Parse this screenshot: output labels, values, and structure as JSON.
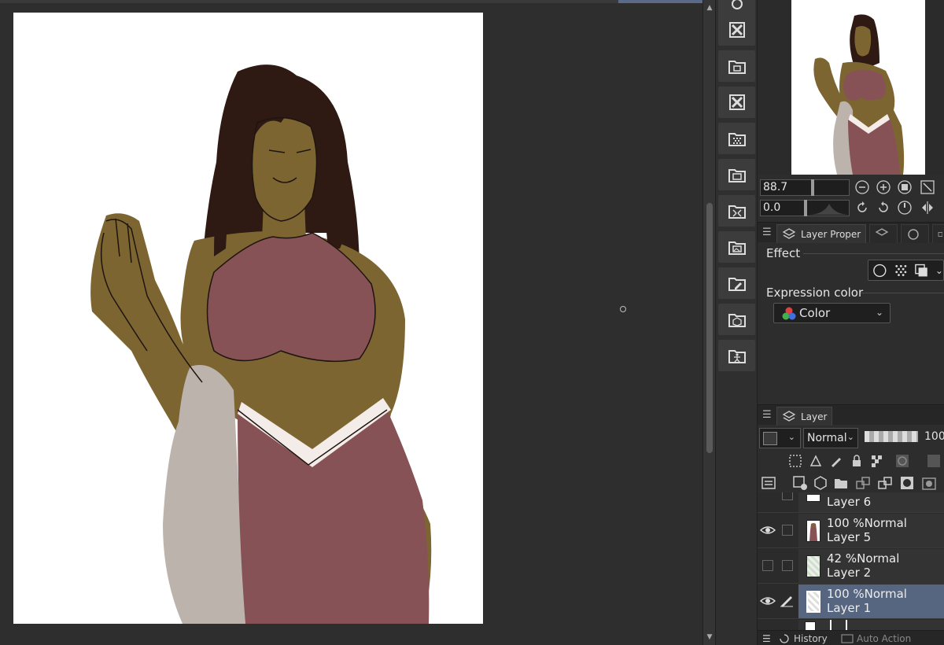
{
  "navigator": {
    "zoom_value": "88.7",
    "rotation_value": "0.0"
  },
  "property_panel": {
    "tab_label": "Layer Proper",
    "effect_label": "Effect",
    "expression_color_label": "Expression color",
    "expression_color_value": "Color"
  },
  "layer_panel": {
    "tab_label": "Layer",
    "blend_mode": "Normal",
    "opacity": "100",
    "layers": [
      {
        "opacity": "",
        "mode": "",
        "name": "Layer 6",
        "visible": false,
        "selected": false
      },
      {
        "opacity": "100 %",
        "mode": "Normal",
        "name": "Layer 5",
        "visible": true,
        "selected": false
      },
      {
        "opacity": "42 %",
        "mode": "Normal",
        "name": "Layer 2",
        "visible": false,
        "selected": false
      },
      {
        "opacity": "100 %",
        "mode": "Normal",
        "name": "Layer 1",
        "visible": true,
        "selected": true
      }
    ]
  },
  "bottom_tabs": {
    "history": "History",
    "auto_action": "Auto Action"
  },
  "colors": {
    "skin": "#7d6532",
    "dress": "#865256",
    "drape": "#bdb3ad",
    "hair": "#2e1a12",
    "selected_layer": "#566680"
  }
}
